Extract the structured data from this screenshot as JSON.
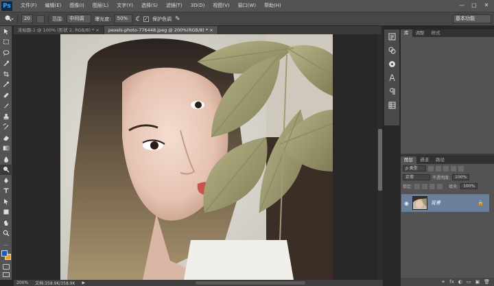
{
  "app": {
    "logo_text": "Ps"
  },
  "menu": [
    "文件(F)",
    "编辑(E)",
    "图像(I)",
    "图层(L)",
    "文字(Y)",
    "选择(S)",
    "滤镜(T)",
    "3D(D)",
    "视图(V)",
    "窗口(W)",
    "帮助(H)"
  ],
  "window_controls": {
    "minimize": "—",
    "maximize": "□",
    "close": "✕"
  },
  "options": {
    "brush_size": "20",
    "range_label": "范围:",
    "range_value": "中间调",
    "exposure_label": "曝光度:",
    "exposure_value": "50%",
    "protect_tones_label": "保护色调",
    "protect_tones_checked": true,
    "workspace_label": "基本功能"
  },
  "tabs": [
    {
      "label": "未标题-1 @ 100% (形状 2, RGB/8) *",
      "active": false,
      "close": "×"
    },
    {
      "label": "pexels-photo-776448.jpeg @ 200%(RGB/8) *",
      "active": true,
      "close": "×"
    }
  ],
  "status": {
    "zoom": "200%",
    "doc": "文档:358.9K/358.9K",
    "arrow": "▶"
  },
  "panel_top_tabs": [
    "库",
    "调整",
    "样式"
  ],
  "layers_panel": {
    "tabs": [
      "图层",
      "通道",
      "路径"
    ],
    "kind_label": "ρ 类型",
    "blend_mode": "正常",
    "opacity_label": "不透明度:",
    "opacity_value": "100%",
    "lock_label": "锁定:",
    "fill_label": "填充:",
    "fill_value": "100%",
    "layer_name": "背景",
    "bottom_icons": [
      "fx",
      "◐",
      "▭",
      "▣",
      "🗑"
    ]
  },
  "colors": {
    "foreground": "#0a5bd8",
    "background": "#ff9900",
    "selected_layer": "#6a7f9a"
  },
  "tools": [
    "move-tool-icon",
    "marquee-tool-icon",
    "lasso-tool-icon",
    "quick-select-icon",
    "crop-tool-icon",
    "eyedropper-icon",
    "healing-brush-icon",
    "brush-tool-icon",
    "clone-stamp-icon",
    "history-brush-icon",
    "eraser-icon",
    "gradient-icon",
    "blur-icon",
    "dodge-icon",
    "pen-icon",
    "type-icon",
    "path-select-icon",
    "shape-icon",
    "hand-icon",
    "zoom-icon"
  ]
}
